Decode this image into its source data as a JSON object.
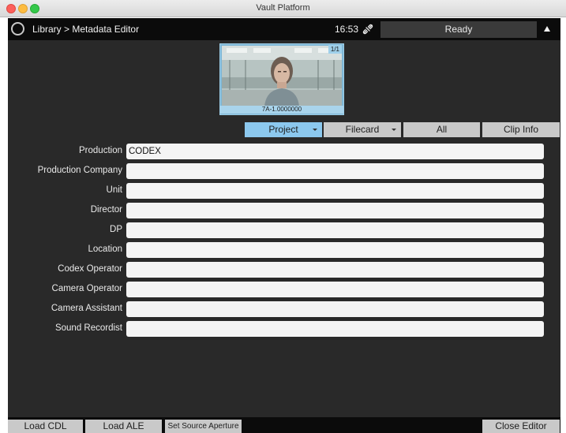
{
  "window": {
    "title": "Vault Platform"
  },
  "header": {
    "breadcrumb": "Library > Metadata Editor",
    "time": "16:53",
    "status": "Ready"
  },
  "thumbnail": {
    "counter": "1/1",
    "clip_name": "7A-1.0000000"
  },
  "tabs": [
    {
      "label": "Project",
      "active": true,
      "has_dropdown": true
    },
    {
      "label": "Filecard",
      "active": false,
      "has_dropdown": true
    },
    {
      "label": "All",
      "active": false,
      "has_dropdown": false
    },
    {
      "label": "Clip Info",
      "active": false,
      "has_dropdown": false
    }
  ],
  "fields": [
    {
      "label": "Production",
      "value": "CODEX"
    },
    {
      "label": "Production Company",
      "value": ""
    },
    {
      "label": "Unit",
      "value": ""
    },
    {
      "label": "Director",
      "value": ""
    },
    {
      "label": "DP",
      "value": ""
    },
    {
      "label": "Location",
      "value": ""
    },
    {
      "label": "Codex Operator",
      "value": ""
    },
    {
      "label": "Camera Operator",
      "value": ""
    },
    {
      "label": "Camera Assistant",
      "value": ""
    },
    {
      "label": "Sound Recordist",
      "value": ""
    }
  ],
  "footer": {
    "load_cdl": "Load CDL",
    "load_ale": "Load ALE",
    "set_source_aperture": "Set Source Aperture",
    "close_editor": "Close Editor"
  },
  "icons": {
    "home": "circle-icon",
    "link": "broken-link-icon",
    "expand": "triangle-up-icon"
  },
  "colors": {
    "accent_tab": "#8cc8ee",
    "panel_bg": "#292929",
    "bar_bg": "#0b0b0b"
  }
}
